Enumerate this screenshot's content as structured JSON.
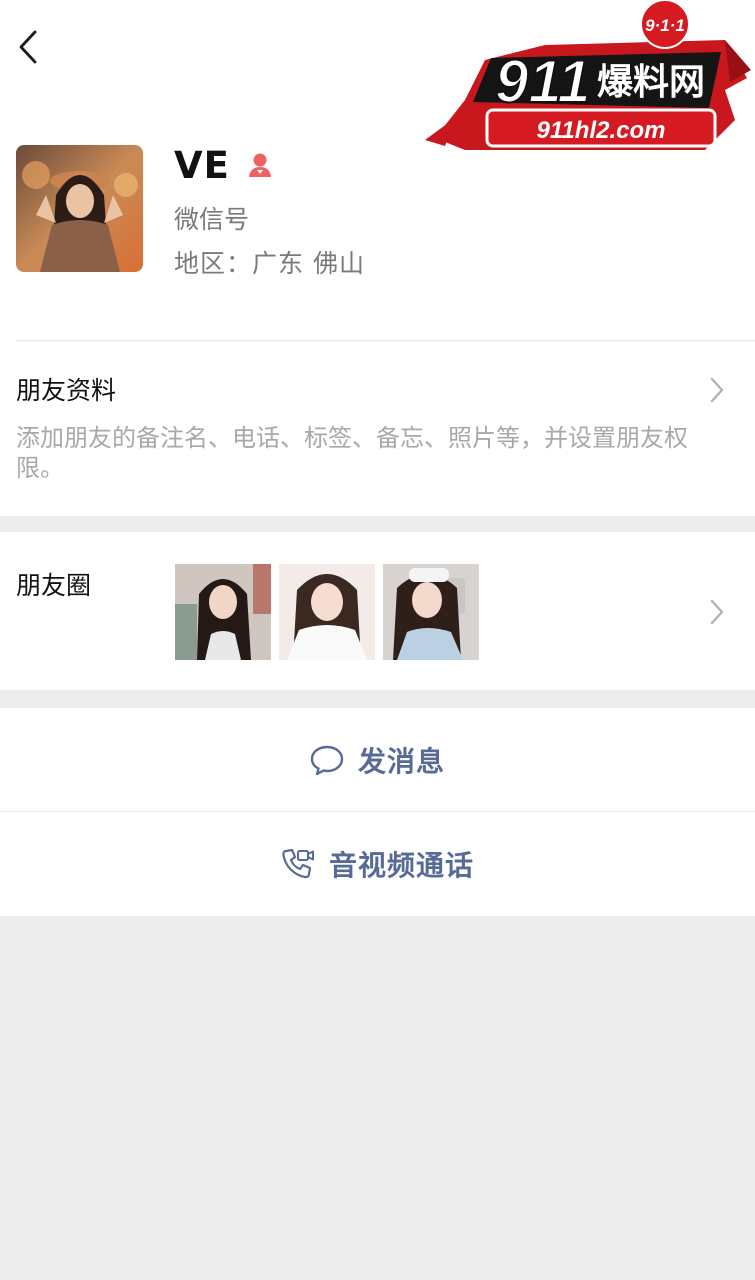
{
  "watermark": {
    "badge": "9·1·1",
    "big": "911",
    "cn": "爆料网",
    "url": "911hl2.com"
  },
  "profile": {
    "name": "VE",
    "gender_icon": "female-icon",
    "wechat_id_label": "微信号",
    "region": "地区：广东 佛山"
  },
  "friend_info": {
    "title": "朋友资料",
    "description": "添加朋友的备注名、电话、标签、备忘、照片等，并设置朋友权限。"
  },
  "moments": {
    "title": "朋友圈",
    "thumbnails": [
      "moment-photo-1",
      "moment-photo-2",
      "moment-photo-3"
    ]
  },
  "actions": {
    "message_label": "发消息",
    "call_label": "音视频通话"
  },
  "colors": {
    "action_blue": "#576b95",
    "female_icon": "#f06262",
    "background_gray": "#ececec"
  }
}
